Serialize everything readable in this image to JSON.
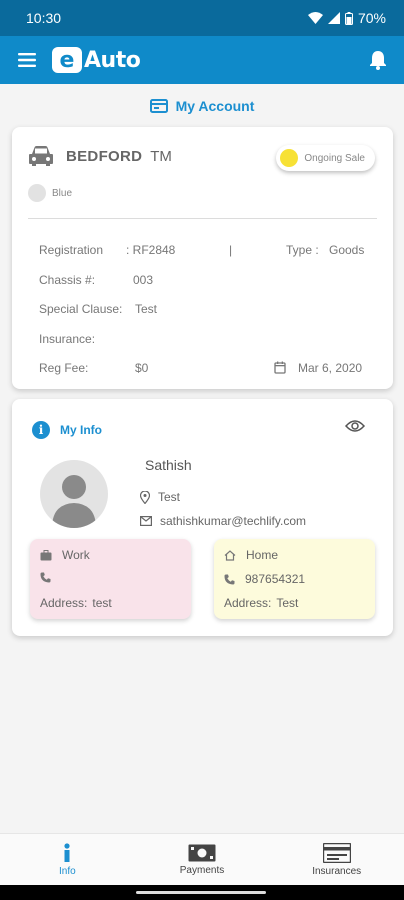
{
  "status_bar": {
    "time": "10:30",
    "battery": "70%"
  },
  "app_bar": {
    "logo_letter": "e",
    "logo_text": "Auto"
  },
  "account": {
    "title": "My Account"
  },
  "vehicle": {
    "make": "BEDFORD",
    "model": "TM",
    "status": "Ongoing Sale",
    "status_color": "#f7e135",
    "color_name": "Blue",
    "registration_label": "Registration",
    "registration_value": ": RF2848",
    "separator": "|",
    "type_label": "Type :",
    "type_value": "Goods",
    "chassis_label": "Chassis #:",
    "chassis_value": "003",
    "special_label": "Special Clause:",
    "special_value": "Test",
    "insurance_label": "Insurance:",
    "regfee_label": "Reg Fee:",
    "regfee_value": "$0",
    "date_value": "Mar 6, 2020"
  },
  "my_info": {
    "title": "My Info",
    "name": "Sathish",
    "location": "Test",
    "email": "sathishkumar@techlify.com",
    "work": {
      "label": "Work",
      "phone": "",
      "address_label": "Address:",
      "address_value": "test"
    },
    "home": {
      "label": "Home",
      "phone": "987654321",
      "address_label": "Address:",
      "address_value": "Test"
    }
  },
  "bottom_nav": [
    {
      "label": "Info",
      "icon": "info-icon",
      "active": true
    },
    {
      "label": "Payments",
      "icon": "cash-icon",
      "active": false
    },
    {
      "label": "Insurances",
      "icon": "card-icon",
      "active": false
    }
  ],
  "colors": {
    "primary": "#0f8ac9",
    "status_bar": "#0a6a9c",
    "accent": "#1c8fd0",
    "work_bg": "#f9e3ea",
    "home_bg": "#fdfbdc"
  }
}
